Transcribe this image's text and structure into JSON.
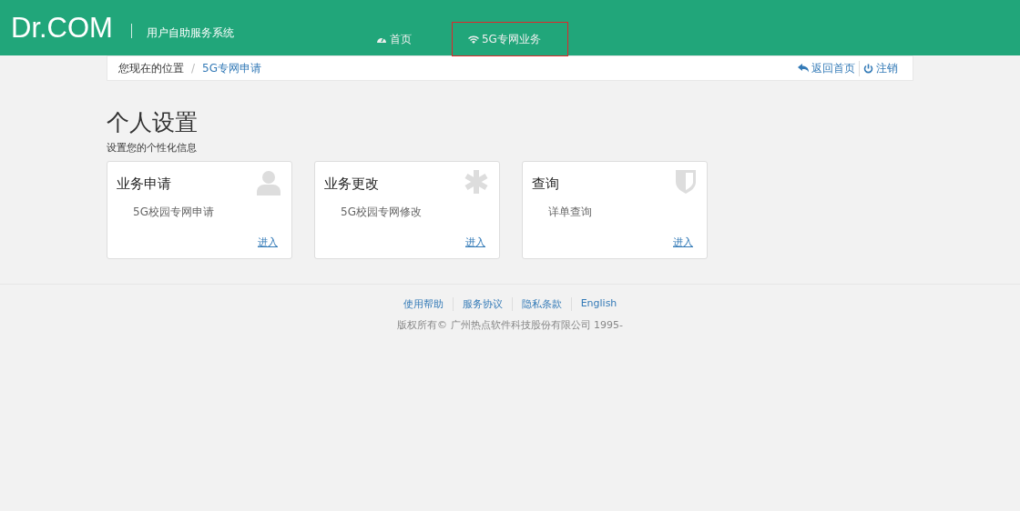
{
  "header": {
    "logo": "Dr.COM",
    "subtitle": "用户自助服务系统",
    "nav": [
      {
        "kind": "dashboard",
        "label": "首页",
        "highlighted": false
      },
      {
        "kind": "wifi",
        "label": "5G专网业务",
        "highlighted": true
      }
    ]
  },
  "breadcrumb": {
    "prefix": "您现在的位置",
    "separator": "/",
    "current": "5G专网申请",
    "actions": [
      {
        "kind": "back",
        "label": "返回首页"
      },
      {
        "kind": "power",
        "label": "注销"
      }
    ]
  },
  "page": {
    "title": "个人设置",
    "subtitle": "设置您的个性化信息"
  },
  "cards": [
    {
      "kind": "user",
      "title": "业务申请",
      "description": "5G校园专网申请",
      "link": "进入"
    },
    {
      "kind": "asterisk",
      "title": "业务更改",
      "description": "5G校园专网修改",
      "link": "进入"
    },
    {
      "kind": "shield",
      "title": "查询",
      "description": "详单查询",
      "link": "进入"
    }
  ],
  "footer": {
    "links": [
      "使用帮助",
      "服务协议",
      "隐私条款",
      "English"
    ],
    "copyright": "版权所有© 广州热点软件科技股份有限公司 1995-"
  }
}
